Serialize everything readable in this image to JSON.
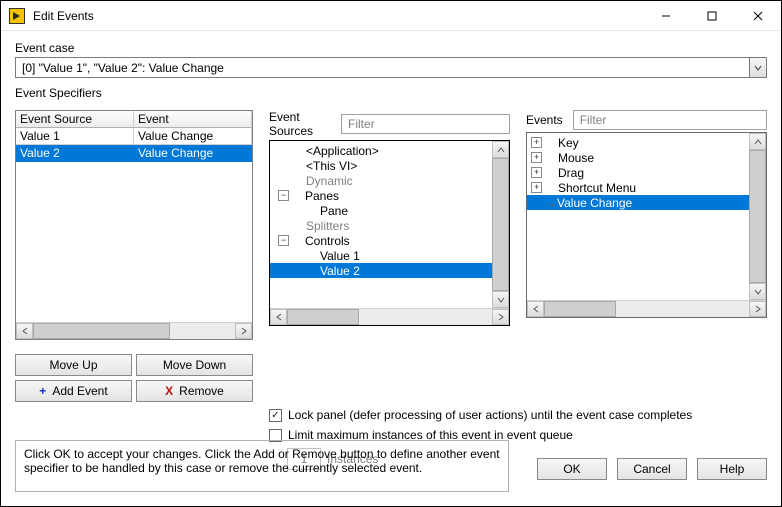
{
  "window": {
    "title": "Edit Events"
  },
  "event_case": {
    "label": "Event case",
    "value": "[0] \"Value 1\", \"Value 2\": Value Change"
  },
  "specifiers": {
    "label": "Event Specifiers",
    "headers": {
      "source": "Event Source",
      "event": "Event"
    },
    "rows": [
      {
        "source": "Value 1",
        "event": "Value Change",
        "selected": false
      },
      {
        "source": "Value 2",
        "event": "Value Change",
        "selected": true
      }
    ],
    "buttons": {
      "move_up": "Move Up",
      "move_down": "Move Down",
      "add": "Add Event",
      "remove": "Remove"
    }
  },
  "sources": {
    "label": "Event Sources",
    "filter_placeholder": "Filter",
    "tree": [
      {
        "indent": 1,
        "text": "<Application>",
        "dim": false
      },
      {
        "indent": 1,
        "text": "<This VI>",
        "dim": false
      },
      {
        "indent": 1,
        "text": "Dynamic",
        "dim": true
      },
      {
        "indent": 0,
        "text": "Panes",
        "toggle": "-"
      },
      {
        "indent": 2,
        "text": "Pane"
      },
      {
        "indent": 1,
        "text": "Splitters",
        "dim": true
      },
      {
        "indent": 0,
        "text": "Controls",
        "toggle": "-"
      },
      {
        "indent": 2,
        "text": "Value 1"
      },
      {
        "indent": 2,
        "text": "Value 2",
        "selected": true
      }
    ]
  },
  "events": {
    "label": "Events",
    "filter_placeholder": "Filter",
    "tree": [
      {
        "toggle": "+",
        "text": "Key"
      },
      {
        "toggle": "+",
        "text": "Mouse"
      },
      {
        "toggle": "+",
        "text": "Drag"
      },
      {
        "toggle": "+",
        "text": "Shortcut Menu"
      },
      {
        "bullet": "→",
        "text": "Value Change",
        "selected": true
      }
    ]
  },
  "options": {
    "lock_panel": {
      "checked": true,
      "label": "Lock panel (defer processing of user actions) until the event case completes"
    },
    "limit": {
      "checked": false,
      "label": "Limit maximum instances of this event in event queue"
    },
    "instances_value": "1",
    "instances_label": "Instances"
  },
  "help_text": "Click OK to accept your changes.  Click the Add or Remove button to define another event specifier to be handled by this case or remove the currently selected event.",
  "footer": {
    "ok": "OK",
    "cancel": "Cancel",
    "help": "Help"
  }
}
